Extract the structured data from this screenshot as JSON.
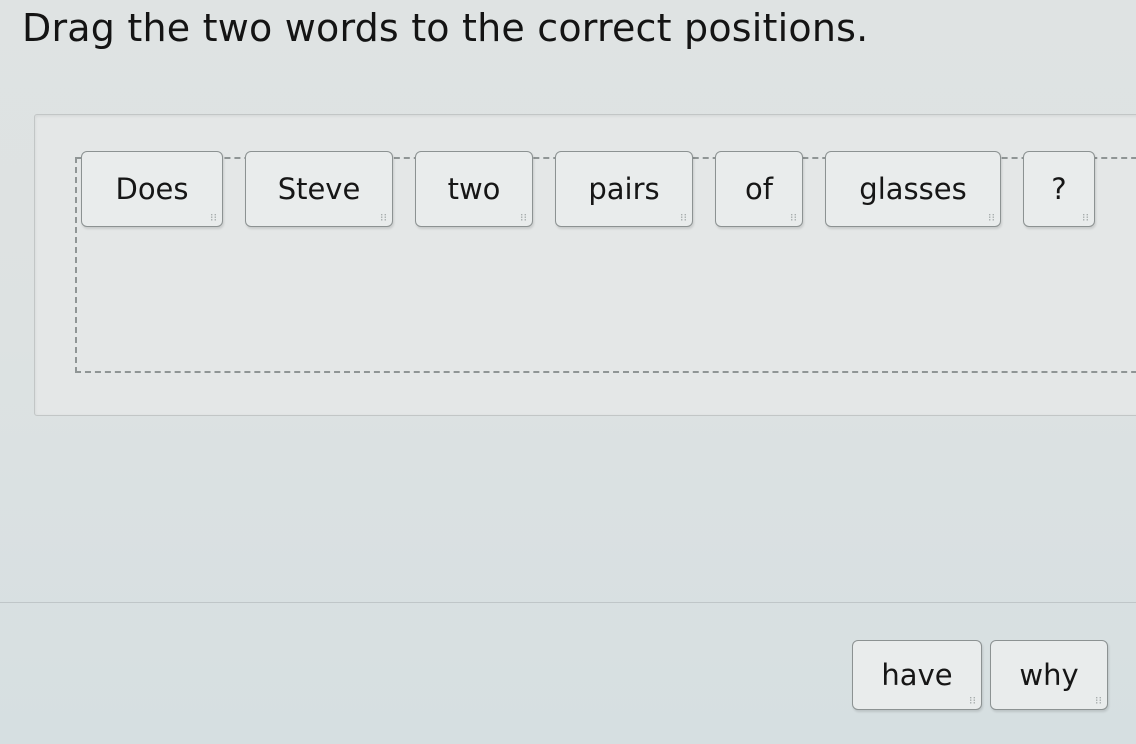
{
  "instruction": "Drag the two words to the correct positions.",
  "sentence_words": [
    {
      "label": "Does"
    },
    {
      "label": "Steve"
    },
    {
      "label": "two"
    },
    {
      "label": "pairs"
    },
    {
      "label": "of"
    },
    {
      "label": "glasses"
    },
    {
      "label": "?"
    }
  ],
  "word_bank": [
    {
      "label": "have"
    },
    {
      "label": "why"
    }
  ],
  "icons": {
    "drag_handle": "grip-dots-icon"
  }
}
